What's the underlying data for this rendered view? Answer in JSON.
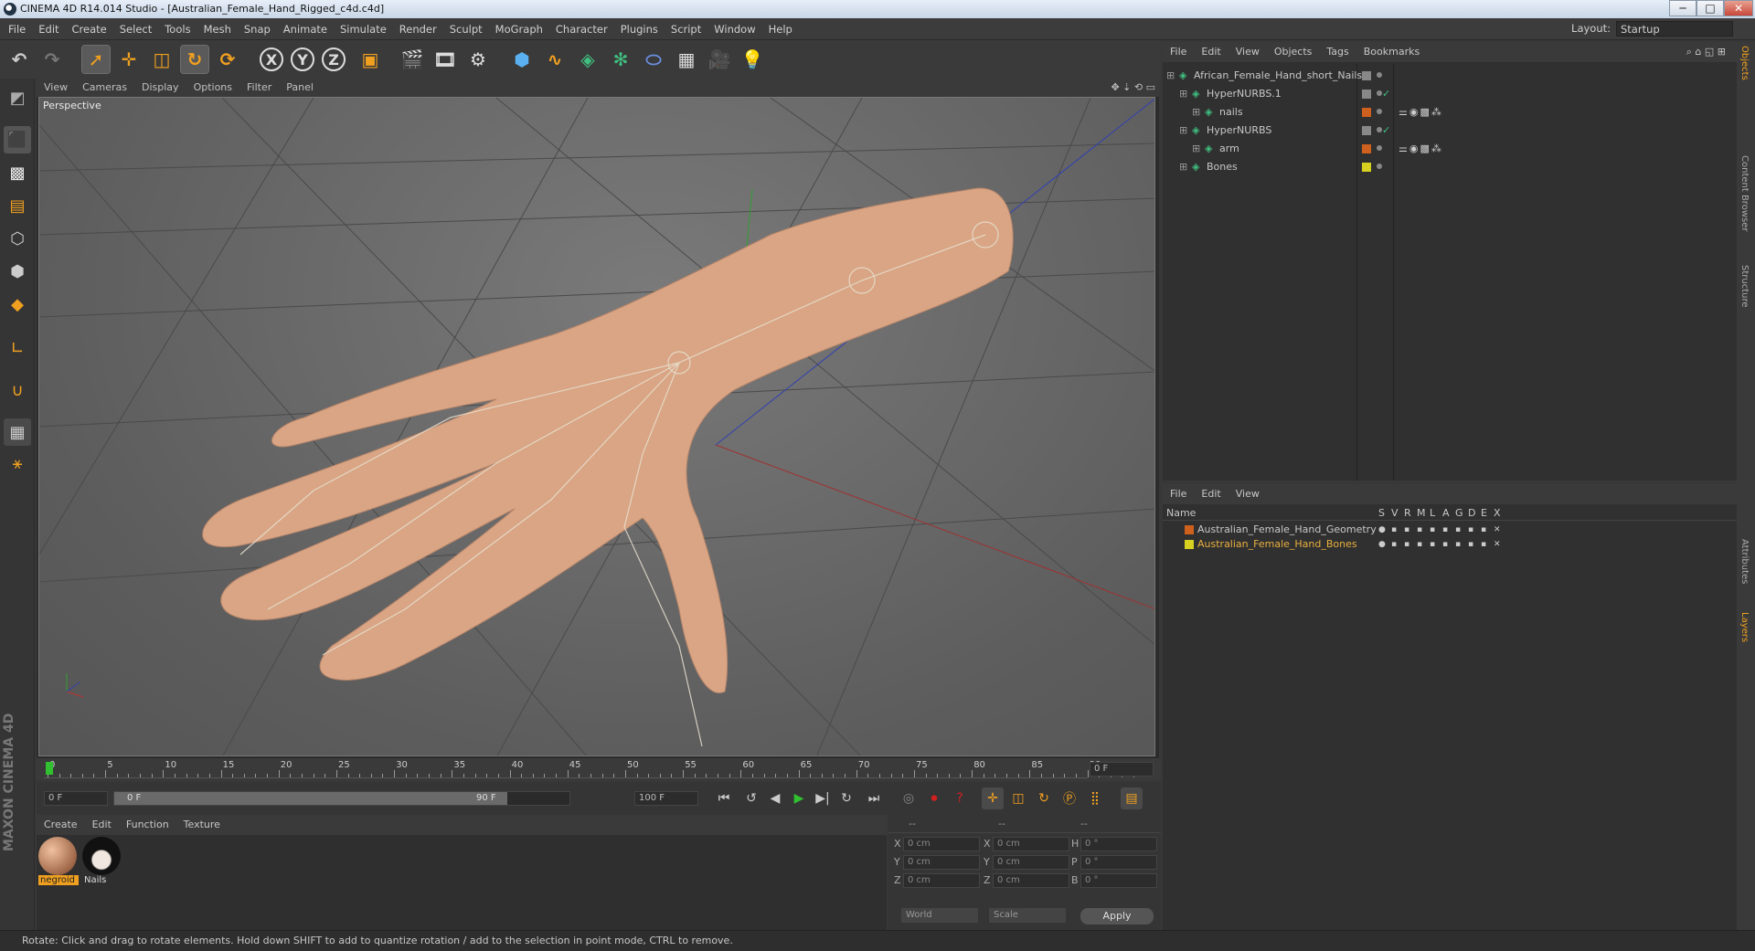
{
  "window": {
    "title": "CINEMA 4D R14.014 Studio - [Australian_Female_Hand_Rigged_c4d.c4d]",
    "min": "─",
    "max": "□",
    "close": "✕"
  },
  "menu": [
    "File",
    "Edit",
    "Create",
    "Select",
    "Tools",
    "Mesh",
    "Snap",
    "Animate",
    "Simulate",
    "Render",
    "Sculpt",
    "MoGraph",
    "Character",
    "Plugins",
    "Script",
    "Window",
    "Help"
  ],
  "layout": {
    "label": "Layout:",
    "value": "Startup"
  },
  "toolbar": {
    "x": "X",
    "y": "Y",
    "z": "Z"
  },
  "viewport": {
    "menu": [
      "View",
      "Cameras",
      "Display",
      "Options",
      "Filter",
      "Panel"
    ],
    "label": "Perspective"
  },
  "timeline": {
    "ticks": [
      "0",
      "5",
      "10",
      "15",
      "20",
      "25",
      "30",
      "35",
      "40",
      "45",
      "50",
      "55",
      "60",
      "65",
      "70",
      "75",
      "80",
      "85",
      "90"
    ],
    "frame_field": "0 F"
  },
  "controls": {
    "start": "0 F",
    "range_start": "0 F",
    "range_end": "90 F",
    "end": "100 F"
  },
  "materials": {
    "menu": [
      "Create",
      "Edit",
      "Function",
      "Texture"
    ],
    "items": [
      {
        "name": "negroid",
        "selected": true
      },
      {
        "name": "Nails",
        "selected": false
      }
    ]
  },
  "coords": {
    "headers": [
      "--",
      "--",
      "--"
    ],
    "rows": [
      {
        "a": "X",
        "av": "0 cm",
        "b": "X",
        "bv": "0 cm",
        "c": "H",
        "cv": "0 °"
      },
      {
        "a": "Y",
        "av": "0 cm",
        "b": "Y",
        "bv": "0 cm",
        "c": "P",
        "cv": "0 °"
      },
      {
        "a": "Z",
        "av": "0 cm",
        "b": "Z",
        "bv": "0 cm",
        "c": "B",
        "cv": "0 °"
      }
    ],
    "mode1": "World",
    "mode2": "Scale",
    "apply": "Apply"
  },
  "objects": {
    "menu": [
      "File",
      "Edit",
      "View",
      "Objects",
      "Tags",
      "Bookmarks"
    ],
    "tree": [
      {
        "name": "African_Female_Hand_short_Nails",
        "indent": 0,
        "color": "#888888"
      },
      {
        "name": "HyperNURBS.1",
        "indent": 1,
        "color": "#888888"
      },
      {
        "name": "nails",
        "indent": 2,
        "color": "#d0601e"
      },
      {
        "name": "HyperNURBS",
        "indent": 1,
        "color": "#888888"
      },
      {
        "name": "arm",
        "indent": 2,
        "color": "#d0601e"
      },
      {
        "name": "Bones",
        "indent": 1,
        "color": "#d8d020"
      }
    ]
  },
  "layers": {
    "menu": [
      "File",
      "Edit",
      "View"
    ],
    "headers": {
      "name": "Name",
      "cols": [
        "S",
        "V",
        "R",
        "M",
        "L",
        "A",
        "G",
        "D",
        "E",
        "X"
      ]
    },
    "items": [
      {
        "name": "Australian_Female_Hand_Geometry",
        "color": "#d0601e",
        "text_color": "#c8c8c8"
      },
      {
        "name": "Australian_Female_Hand_Bones",
        "color": "#d8d020",
        "text_color": "#e8b040"
      }
    ]
  },
  "sidetabs": [
    "Objects",
    "Content Browser",
    "Structure",
    "Attributes",
    "Layers"
  ],
  "brand": "MAXON CINEMA 4D",
  "status": "Rotate: Click and drag to rotate elements. Hold down SHIFT to add to quantize rotation / add to the selection in point mode, CTRL to remove.",
  "colors": {
    "accent": "#f0a020",
    "play": "#30c030",
    "record": "#d02020"
  }
}
